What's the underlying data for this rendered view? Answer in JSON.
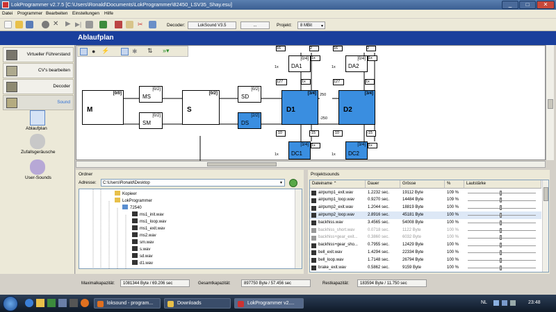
{
  "window": {
    "title": "LokProgrammer  v2.7.5  [C:\\Users\\Ronald\\Documents\\LokProgrammer\\82450_LSV35_Shay.esu]"
  },
  "menu": [
    "Datei",
    "Programmer",
    "Bearbeiten",
    "Einstellungen",
    "Hilfe"
  ],
  "toolbar": {
    "decoder_label": "Decoder:",
    "decoder_value": "LokSound V3.5",
    "decoder_extra": "...",
    "projekt_label": "Projekt:",
    "projekt_value": "8 MBit"
  },
  "banner": {
    "title": "Ablaufplan"
  },
  "nav": [
    {
      "label": "Virtueller Führerstand"
    },
    {
      "label": "CV's bearbeiten"
    },
    {
      "label": "Decoder"
    },
    {
      "label": "Sound"
    }
  ],
  "subnav": [
    {
      "label": "Ablaufplan",
      "icon": "flowchart-icon"
    },
    {
      "label": "Zufallsgeräusche",
      "icon": "random-sounds-icon"
    },
    {
      "label": "User-Sounds",
      "icon": "user-sounds-icon"
    }
  ],
  "diagram": {
    "M": {
      "name": "M",
      "tag": "[0/0]"
    },
    "MS": {
      "name": "MS",
      "tag": "[0/2]"
    },
    "SM": {
      "name": "SM",
      "tag": "[0/2]"
    },
    "S": {
      "name": "S",
      "tag": "[0/2]"
    },
    "SD": {
      "name": "SD",
      "tag": "[0/2]"
    },
    "DS": {
      "name": "DS",
      "tag": "[2/2]"
    },
    "D1": {
      "name": "D1",
      "tag": "[3/4]"
    },
    "D2": {
      "name": "D2",
      "tag": "[3/4]"
    },
    "DA1": {
      "name": "DA1",
      "tag": "[0/4]"
    },
    "DA2": {
      "name": "DA2",
      "tag": "[0/4]"
    },
    "DC1": {
      "name": "DC1",
      "tag": "[3/4]"
    },
    "DC2": {
      "name": "DC2",
      "tag": "[3/4]"
    },
    "values": {
      "v127a": "127",
      "v127b": "127",
      "v250a": "250",
      "v250b": "-250",
      "v10a": "-10",
      "v15a": "-15",
      "v10b": "-10",
      "v15b": "-15",
      "vt1": "1x",
      "vt2": "1x",
      "vt3": "1x",
      "vt4": "1x",
      "vt5": "1x",
      "vt6": "1x",
      "vt7": "1x",
      "vt8": "1x",
      "vt9": "1x",
      "vt10": "1x",
      "vt11": "1x",
      "vt12": "1x",
      "top1": "16",
      "top2": "2",
      "top3": "16",
      "top4": "2"
    }
  },
  "ordner": {
    "title": "Ordner",
    "address_label": "Adresse:",
    "address_value": "C:\\Users\\Ronald\\Desktop",
    "tree": [
      {
        "label": "Kopieer",
        "icon": "folder"
      },
      {
        "label": "LokProgrammer",
        "icon": "folder"
      },
      {
        "label": "72540",
        "icon": "folder"
      },
      {
        "label": "ms1_init.wav",
        "icon": "file"
      },
      {
        "label": "ms1_loop.wav",
        "icon": "file"
      },
      {
        "label": "ms1_exit.wav",
        "icon": "file"
      },
      {
        "label": "ms2.wav",
        "icon": "file"
      },
      {
        "label": "sm.wav",
        "icon": "file"
      },
      {
        "label": "s.wav",
        "icon": "file"
      },
      {
        "label": "sd.wav",
        "icon": "file"
      },
      {
        "label": "d1.wav",
        "icon": "file"
      }
    ]
  },
  "projektsounds": {
    "title": "Projektsounds",
    "columns": [
      "Dateiname",
      "Dauer",
      "Grösse",
      "%",
      "Lautstärke"
    ],
    "rows": [
      {
        "name": "airpump1_exit.wav",
        "dauer": "1.2232 sec.",
        "groesse": "19112 Byte",
        "pct": "109 %",
        "level": 0.49,
        "gray": false
      },
      {
        "name": "airpump1_loop.wav",
        "dauer": "0.9270 sec.",
        "groesse": "14484 Byte",
        "pct": "109 %",
        "level": 0.49,
        "gray": false
      },
      {
        "name": "airpump2_exit.wav",
        "dauer": "1.2044 sec.",
        "groesse": "18819 Byte",
        "pct": "100 %",
        "level": 0.49,
        "gray": false
      },
      {
        "name": "airpump2_loop.wav",
        "dauer": "2.8916 sec.",
        "groesse": "45181 Byte",
        "pct": "100 %",
        "level": 0.49,
        "gray": false
      },
      {
        "name": "backhiss.wav",
        "dauer": "3.4565 sec.",
        "groesse": "54008 Byte",
        "pct": "100 %",
        "level": 0.49,
        "gray": false
      },
      {
        "name": "backhiss_short.wav",
        "dauer": "0.0718 sec.",
        "groesse": "1122 Byte",
        "pct": "100 %",
        "level": 0.49,
        "gray": true
      },
      {
        "name": "backhiss+gear_exit...",
        "dauer": "0.3860 sec.",
        "groesse": "6032 Byte",
        "pct": "100 %",
        "level": 0.49,
        "gray": true
      },
      {
        "name": "backhiss+gear_sho...",
        "dauer": "0.7955 sec.",
        "groesse": "12429 Byte",
        "pct": "100 %",
        "level": 0.49,
        "gray": false
      },
      {
        "name": "bell_exit.wav",
        "dauer": "1.4294 sec.",
        "groesse": "22334 Byte",
        "pct": "100 %",
        "level": 0.49,
        "gray": false
      },
      {
        "name": "bell_loop.wav",
        "dauer": "1.7148 sec.",
        "groesse": "26794 Byte",
        "pct": "100 %",
        "level": 0.49,
        "gray": false
      },
      {
        "name": "brake_exit.wav",
        "dauer": "0.5862 sec.",
        "groesse": "9159 Byte",
        "pct": "100 %",
        "level": 0.49,
        "gray": false
      }
    ]
  },
  "status": {
    "max_label": "Maximalkapazität:",
    "max_value": "1081344 Byte / 69.206 sec",
    "gesamt_label": "Gesamtkapazität:",
    "gesamt_value": "897750 Byte / 57.456 sec",
    "rest_label": "Restkapazität:",
    "rest_value": "183594 Byte / 11.750 sec"
  },
  "taskbar": {
    "tasks": [
      {
        "label": "loksound - program...",
        "color": "#e07020"
      },
      {
        "label": "Downloads",
        "color": "#e8c04a"
      },
      {
        "label": "LokProgrammer  v2....",
        "color": "#c33"
      }
    ],
    "lang": "NL",
    "time": "23:48"
  }
}
